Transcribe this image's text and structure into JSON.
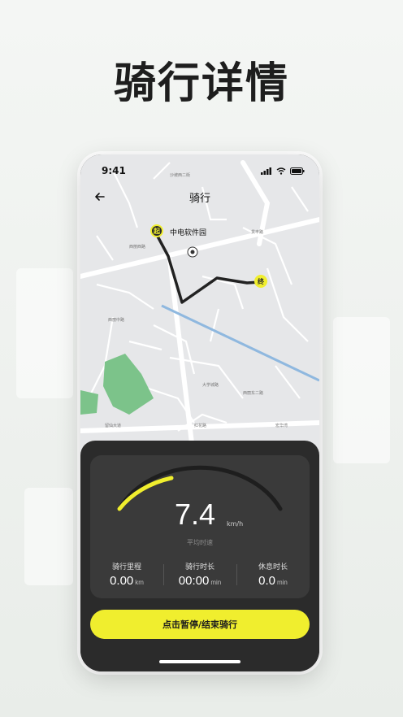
{
  "promo": {
    "title": "骑行详情"
  },
  "status_bar": {
    "time": "9:41"
  },
  "nav": {
    "title": "骑行"
  },
  "map": {
    "start_marker": "起",
    "end_marker": "终",
    "place_label": "中电软件园",
    "streets": [
      "沙坡西二街",
      "西丽西路",
      "贯丰路",
      "西丽中路",
      "北文支路",
      "大学城路",
      "运城街",
      "西丽东二路",
      "科北二路",
      "留仙大道",
      "红花路",
      "宏华湾"
    ]
  },
  "ride": {
    "speed_value": "7.4",
    "speed_unit": "km/h",
    "speed_label": "平均时速",
    "stats": [
      {
        "label": "骑行里程",
        "value": "0.00",
        "unit": "km"
      },
      {
        "label": "骑行时长",
        "value": "00:00",
        "unit": "min"
      },
      {
        "label": "休息时长",
        "value": "0.0",
        "unit": "min"
      }
    ],
    "action_label": "点击暂停/结束骑行"
  },
  "colors": {
    "accent": "#f0ee2e",
    "sheet": "#2b2b2b",
    "card": "#3a3a3a"
  },
  "icons": [
    "back-arrow-icon",
    "signal-icon",
    "wifi-icon",
    "battery-icon",
    "location-dot-icon"
  ]
}
